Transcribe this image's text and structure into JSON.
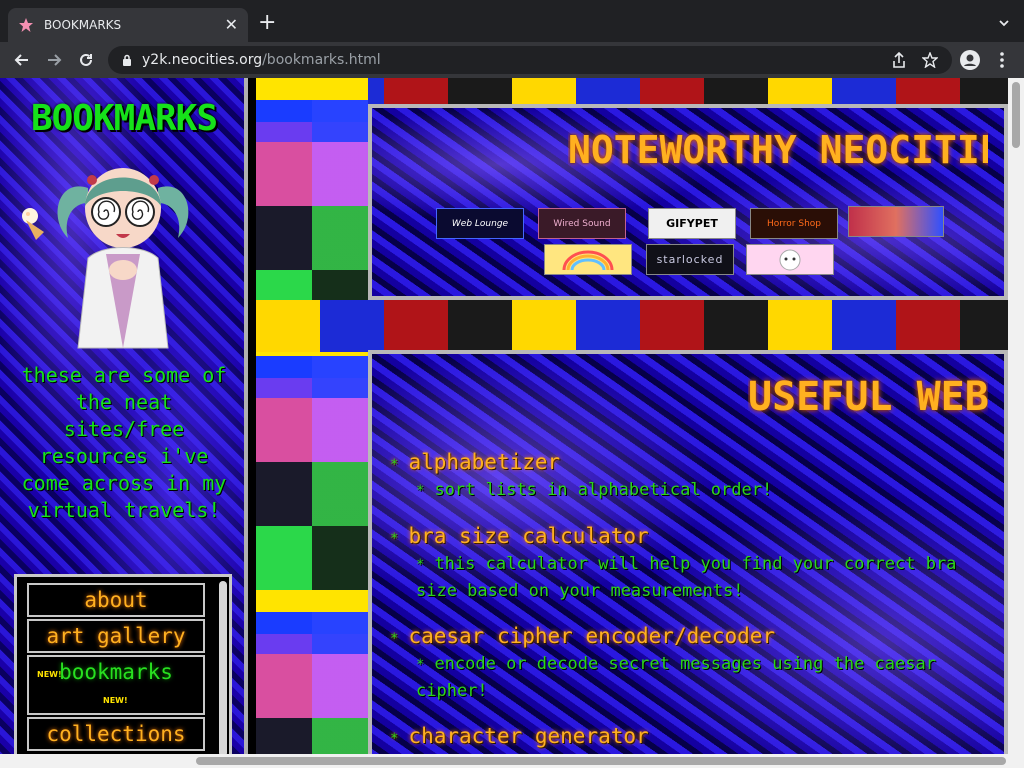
{
  "browser": {
    "tab_title": "BOOKMARKS",
    "url_host": "y2k.neocities.org",
    "url_path": "/bookmarks.html",
    "icons": [
      "star-favicon",
      "close-icon",
      "plus-icon",
      "chevron-down-icon",
      "back-icon",
      "forward-icon",
      "reload-icon",
      "lock-icon",
      "share-icon",
      "star-icon",
      "profile-icon",
      "menu-icon"
    ]
  },
  "sidebar": {
    "title": "BOOKMARKS",
    "intro": "these are some of the neat sites/free resources i've come across in my virtual travels!",
    "nav": [
      {
        "label": "about"
      },
      {
        "label": "art gallery"
      },
      {
        "label": "bookmarks",
        "badge": "NEW!"
      },
      {
        "label": "collections"
      }
    ]
  },
  "noteworthy": {
    "title": "NOTEWORTHY NEOCITIE",
    "buttons": [
      {
        "label": "Web Lounge",
        "kind": "web-lounge"
      },
      {
        "label": "Wired Sound",
        "kind": "wired-sound"
      },
      {
        "label": "GIFYPET",
        "kind": "gifypet"
      },
      {
        "label": "Horror Shop",
        "kind": "horror"
      },
      {
        "label": "",
        "kind": "face"
      },
      {
        "label": "",
        "kind": "rainbow"
      },
      {
        "label": "starlocked",
        "kind": "starlocked"
      },
      {
        "label": "",
        "kind": "cute"
      }
    ]
  },
  "useful": {
    "title": "USEFUL WEB",
    "items": [
      {
        "name": "alphabetizer",
        "desc": "sort lists in alphabetical order!"
      },
      {
        "name": "bra size calculator",
        "desc": "this calculator will help you find your correct bra size based on your measurements!"
      },
      {
        "name": "caesar cipher encoder/decoder",
        "desc": "encode or decode secret messages using the caesar cipher!"
      },
      {
        "name": "character generator",
        "desc": ""
      }
    ]
  },
  "colors": {
    "green_text": "#16e21a",
    "orange_text": "#ffb020",
    "panel_border": "#b8b8b8"
  }
}
